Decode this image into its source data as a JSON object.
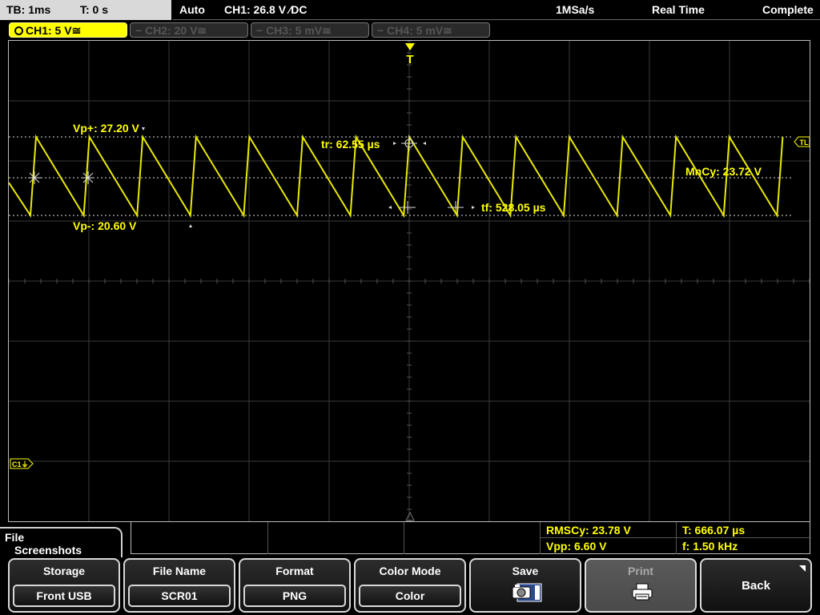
{
  "topbar": {
    "timebase": "TB: 1ms",
    "trigger_time": "T: 0 s",
    "trigger_mode": "Auto",
    "trigger_info": "CH1: 26.8 V ∕DC",
    "sample_rate": "1MSa/s",
    "acq_mode": "Real Time",
    "status": "Complete"
  },
  "channels": [
    {
      "label": "CH1: 5 V≅",
      "active": true
    },
    {
      "label": "CH2: 20 V≅",
      "active": false
    },
    {
      "label": "CH3: 5 mV≅",
      "active": false
    },
    {
      "label": "CH4: 5 mV≅",
      "active": false
    }
  ],
  "scope": {
    "trigger_marker": "T",
    "trigger_level_marker": "TL",
    "channel_marker": "C1⏚",
    "cursors": {
      "vp_plus": "Vp+: 27.20 V",
      "vp_minus": "Vp-: 20.60 V",
      "rise_time": "tr: 62.55 µs",
      "fall_time": "tf: 528.05 µs",
      "mean_cycle": "MnCy: 23.72 V"
    },
    "colors": {
      "trace": "#e8e800",
      "grid": "#3a3a3a",
      "text": "#ffff00"
    }
  },
  "measurements": {
    "rms_cycle": "RMSCy: 23.78 V",
    "vpp": "Vpp: 6.60 V",
    "period": "T: 666.07 µs",
    "frequency": "f: 1.50 kHz"
  },
  "menu": {
    "title_line1": "File",
    "title_line2": "Screenshots"
  },
  "softkeys": {
    "storage": {
      "label": "Storage",
      "value": "Front USB"
    },
    "file_name": {
      "label": "File Name",
      "value": "SCR01"
    },
    "format": {
      "label": "Format",
      "value": "PNG"
    },
    "color_mode": {
      "label": "Color Mode",
      "value": "Color"
    },
    "save": {
      "label": "Save",
      "icon": "camera-save-icon"
    },
    "print": {
      "label": "Print",
      "icon": "printer-icon"
    },
    "back": {
      "label": "Back"
    }
  }
}
